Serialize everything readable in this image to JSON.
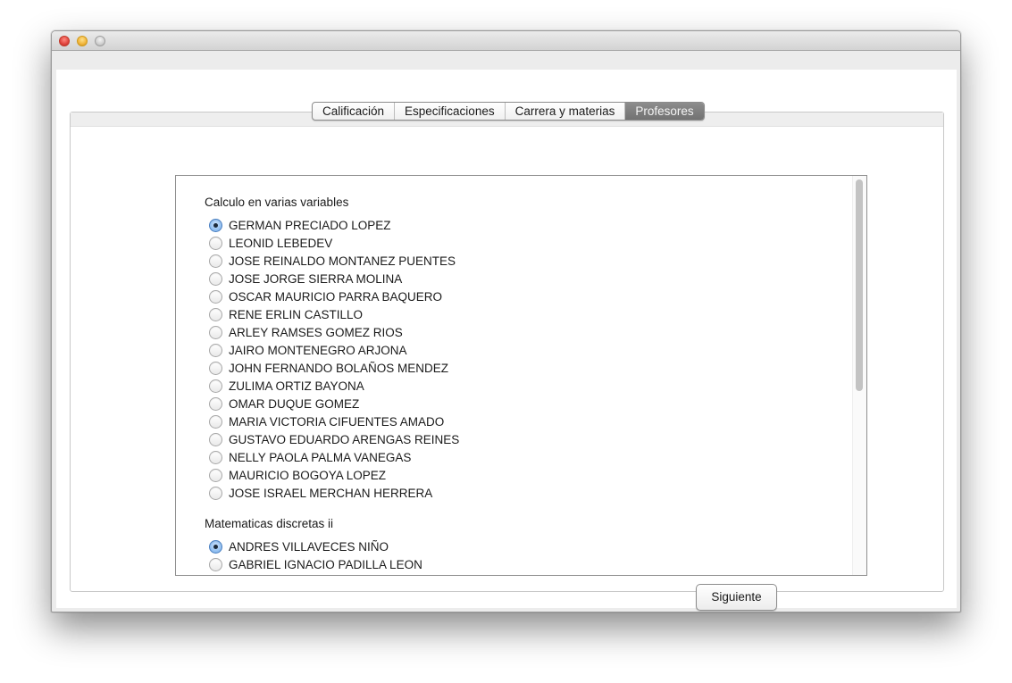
{
  "tabs": {
    "items": [
      {
        "label": "Calificación",
        "active": false
      },
      {
        "label": "Especificaciones",
        "active": false
      },
      {
        "label": "Carrera y materias",
        "active": false
      },
      {
        "label": "Profesores",
        "active": true
      }
    ]
  },
  "groups": [
    {
      "title": "Calculo en varias variables",
      "options": [
        {
          "label": "GERMAN PRECIADO LOPEZ",
          "checked": true
        },
        {
          "label": "LEONID LEBEDEV",
          "checked": false
        },
        {
          "label": "JOSE REINALDO MONTANEZ PUENTES",
          "checked": false
        },
        {
          "label": "JOSE JORGE SIERRA MOLINA",
          "checked": false
        },
        {
          "label": "OSCAR MAURICIO PARRA BAQUERO",
          "checked": false
        },
        {
          "label": "RENE ERLIN CASTILLO",
          "checked": false
        },
        {
          "label": "ARLEY RAMSES GOMEZ RIOS",
          "checked": false
        },
        {
          "label": "JAIRO MONTENEGRO ARJONA",
          "checked": false
        },
        {
          "label": "JOHN FERNANDO BOLAÑOS MENDEZ",
          "checked": false
        },
        {
          "label": "ZULIMA ORTIZ BAYONA",
          "checked": false
        },
        {
          "label": "OMAR DUQUE GOMEZ",
          "checked": false
        },
        {
          "label": "MARIA VICTORIA CIFUENTES AMADO",
          "checked": false
        },
        {
          "label": "GUSTAVO EDUARDO ARENGAS REINES",
          "checked": false
        },
        {
          "label": "NELLY PAOLA PALMA VANEGAS",
          "checked": false
        },
        {
          "label": "MAURICIO BOGOYA LOPEZ",
          "checked": false
        },
        {
          "label": "JOSE ISRAEL MERCHAN HERRERA",
          "checked": false
        }
      ]
    },
    {
      "title": "Matematicas discretas ii",
      "options": [
        {
          "label": "ANDRES VILLAVECES NIÑO",
          "checked": true
        },
        {
          "label": "GABRIEL IGNACIO PADILLA LEON",
          "checked": false
        }
      ]
    }
  ],
  "buttons": {
    "next_label": "Siguiente"
  }
}
